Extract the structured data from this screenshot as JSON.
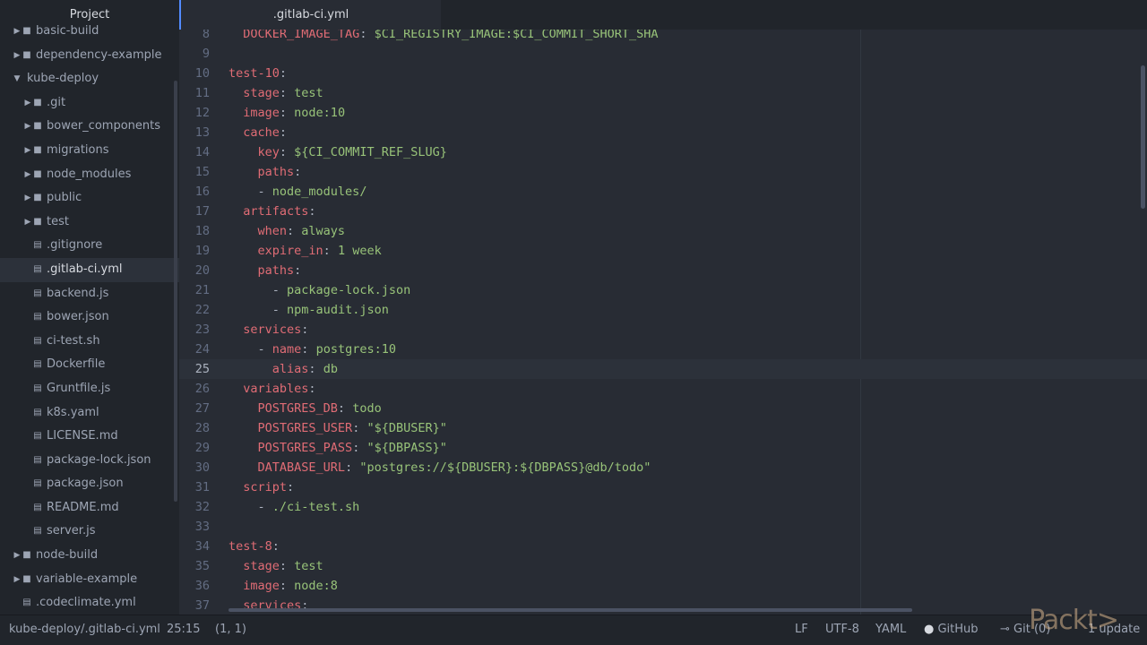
{
  "panel": {
    "title": "Project"
  },
  "tree": [
    {
      "label": "basic-build",
      "depth": 1,
      "type": "folder",
      "state": "collapsed"
    },
    {
      "label": "dependency-example",
      "depth": 1,
      "type": "folder",
      "state": "collapsed"
    },
    {
      "label": "kube-deploy",
      "depth": 1,
      "type": "folder",
      "state": "expanded"
    },
    {
      "label": ".git",
      "depth": 2,
      "type": "folder",
      "state": "collapsed"
    },
    {
      "label": "bower_components",
      "depth": 2,
      "type": "folder",
      "state": "collapsed"
    },
    {
      "label": "migrations",
      "depth": 2,
      "type": "folder",
      "state": "collapsed"
    },
    {
      "label": "node_modules",
      "depth": 2,
      "type": "folder",
      "state": "collapsed"
    },
    {
      "label": "public",
      "depth": 2,
      "type": "folder",
      "state": "collapsed"
    },
    {
      "label": "test",
      "depth": 2,
      "type": "folder",
      "state": "collapsed"
    },
    {
      "label": ".gitignore",
      "depth": 2,
      "type": "file"
    },
    {
      "label": ".gitlab-ci.yml",
      "depth": 2,
      "type": "file",
      "selected": true
    },
    {
      "label": "backend.js",
      "depth": 2,
      "type": "file"
    },
    {
      "label": "bower.json",
      "depth": 2,
      "type": "file"
    },
    {
      "label": "ci-test.sh",
      "depth": 2,
      "type": "file"
    },
    {
      "label": "Dockerfile",
      "depth": 2,
      "type": "file"
    },
    {
      "label": "Gruntfile.js",
      "depth": 2,
      "type": "file"
    },
    {
      "label": "k8s.yaml",
      "depth": 2,
      "type": "file"
    },
    {
      "label": "LICENSE.md",
      "depth": 2,
      "type": "file"
    },
    {
      "label": "package-lock.json",
      "depth": 2,
      "type": "file"
    },
    {
      "label": "package.json",
      "depth": 2,
      "type": "file"
    },
    {
      "label": "README.md",
      "depth": 2,
      "type": "file"
    },
    {
      "label": "server.js",
      "depth": 2,
      "type": "file"
    },
    {
      "label": "node-build",
      "depth": 1,
      "type": "folder",
      "state": "collapsed"
    },
    {
      "label": "variable-example",
      "depth": 1,
      "type": "folder",
      "state": "collapsed"
    },
    {
      "label": ".codeclimate.yml",
      "depth": 1,
      "type": "file"
    }
  ],
  "tab": {
    "title": ".gitlab-ci.yml"
  },
  "code": [
    {
      "n": "8",
      "indent": "  ",
      "key": "DOCKER_IMAGE_TAG",
      "sep": ": ",
      "val": "$CI_REGISTRY_IMAGE:$CI_COMMIT_SHORT_SHA"
    },
    {
      "n": "9"
    },
    {
      "n": "10",
      "indent": "",
      "key": "test-10",
      "sep": ":"
    },
    {
      "n": "11",
      "indent": "  ",
      "key": "stage",
      "sep": ": ",
      "val": "test"
    },
    {
      "n": "12",
      "indent": "  ",
      "key": "image",
      "sep": ": ",
      "val": "node:10"
    },
    {
      "n": "13",
      "indent": "  ",
      "key": "cache",
      "sep": ":"
    },
    {
      "n": "14",
      "indent": "    ",
      "key": "key",
      "sep": ": ",
      "val": "${CI_COMMIT_REF_SLUG}"
    },
    {
      "n": "15",
      "indent": "    ",
      "key": "paths",
      "sep": ":"
    },
    {
      "n": "16",
      "indent": "    ",
      "dash": "- ",
      "val": "node_modules/"
    },
    {
      "n": "17",
      "indent": "  ",
      "key": "artifacts",
      "sep": ":"
    },
    {
      "n": "18",
      "indent": "    ",
      "key": "when",
      "sep": ": ",
      "val": "always"
    },
    {
      "n": "19",
      "indent": "    ",
      "key": "expire_in",
      "sep": ": ",
      "val": "1 week"
    },
    {
      "n": "20",
      "indent": "    ",
      "key": "paths",
      "sep": ":"
    },
    {
      "n": "21",
      "indent": "      ",
      "dash": "- ",
      "val": "package-lock.json"
    },
    {
      "n": "22",
      "indent": "      ",
      "dash": "- ",
      "val": "npm-audit.json"
    },
    {
      "n": "23",
      "indent": "  ",
      "key": "services",
      "sep": ":"
    },
    {
      "n": "24",
      "indent": "    ",
      "dash": "- ",
      "key": "name",
      "sep": ": ",
      "val": "postgres:10"
    },
    {
      "n": "25",
      "indent": "      ",
      "key": "alias",
      "sep": ": ",
      "val": "db",
      "current": true
    },
    {
      "n": "26",
      "indent": "  ",
      "key": "variables",
      "sep": ":"
    },
    {
      "n": "27",
      "indent": "    ",
      "key": "POSTGRES_DB",
      "sep": ": ",
      "val": "todo"
    },
    {
      "n": "28",
      "indent": "    ",
      "key": "POSTGRES_USER",
      "sep": ": ",
      "val": "\"${DBUSER}\""
    },
    {
      "n": "29",
      "indent": "    ",
      "key": "POSTGRES_PASS",
      "sep": ": ",
      "val": "\"${DBPASS}\""
    },
    {
      "n": "30",
      "indent": "    ",
      "key": "DATABASE_URL",
      "sep": ": ",
      "val": "\"postgres://${DBUSER}:${DBPASS}@db/todo\""
    },
    {
      "n": "31",
      "indent": "  ",
      "key": "script",
      "sep": ":"
    },
    {
      "n": "32",
      "indent": "    ",
      "dash": "- ",
      "val": "./ci-test.sh"
    },
    {
      "n": "33"
    },
    {
      "n": "34",
      "indent": "",
      "key": "test-8",
      "sep": ":"
    },
    {
      "n": "35",
      "indent": "  ",
      "key": "stage",
      "sep": ": ",
      "val": "test"
    },
    {
      "n": "36",
      "indent": "  ",
      "key": "image",
      "sep": ": ",
      "val": "node:8"
    },
    {
      "n": "37",
      "indent": "  ",
      "key": "services",
      "sep": ":"
    }
  ],
  "status": {
    "path": "kube-deploy/.gitlab-ci.yml",
    "cursor": "25:15",
    "selection": "(1, 1)",
    "line_ending": "LF",
    "encoding": "UTF-8",
    "grammar": "YAML",
    "github": "GitHub",
    "git": "Git (0)",
    "updates": "1 update"
  },
  "watermark": "Packt>"
}
